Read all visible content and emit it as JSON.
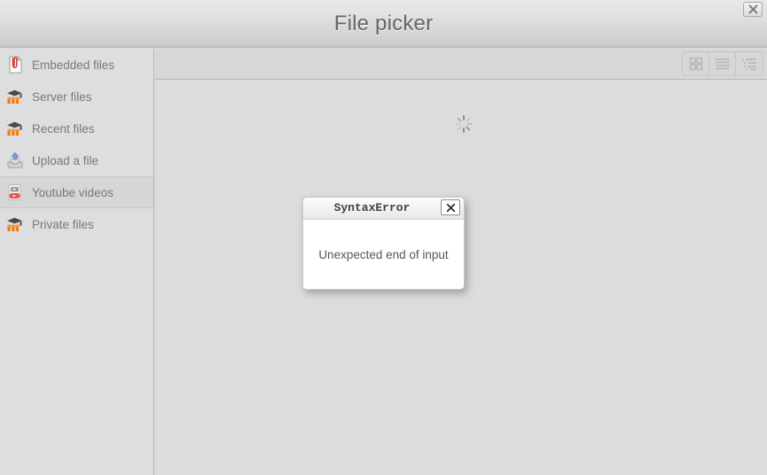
{
  "window": {
    "title": "File picker",
    "close_label": "×",
    "close_icon": "close-icon"
  },
  "sidebar": {
    "items": [
      {
        "label": "Embedded files",
        "icon": "document-paperclip-icon",
        "selected": false
      },
      {
        "label": "Server files",
        "icon": "moodle-logo-icon",
        "selected": false
      },
      {
        "label": "Recent files",
        "icon": "moodle-logo-icon",
        "selected": false
      },
      {
        "label": "Upload a file",
        "icon": "upload-icon",
        "selected": false
      },
      {
        "label": "Youtube videos",
        "icon": "youtube-icon",
        "selected": true
      },
      {
        "label": "Private files",
        "icon": "moodle-logo-icon",
        "selected": false
      }
    ]
  },
  "toolbar": {
    "view_modes": [
      {
        "name": "icon-view",
        "icon": "grid-view-icon",
        "label": "Icon view",
        "active": false
      },
      {
        "name": "list-view",
        "icon": "list-view-icon",
        "label": "List view",
        "active": false
      },
      {
        "name": "tree-view",
        "icon": "tree-view-icon",
        "label": "Tree view",
        "active": false
      }
    ]
  },
  "main": {
    "loading": true,
    "spinner_icon": "loading-spinner-icon"
  },
  "dialog": {
    "title": "SyntaxError",
    "message": "Unexpected end of input",
    "close_label": "✕",
    "close_icon": "close-icon"
  },
  "colors": {
    "header_top": "#e9e9e9",
    "header_bottom": "#c3c3c3",
    "sidebar_bg": "#dedede",
    "sidebar_selected": "#d6d6d6",
    "main_bg": "#dcdcdc",
    "toolbar_bg": "#d7d7d7",
    "title_text": "#63666b",
    "label_text": "#77797d",
    "accent_red": "#d9534f",
    "accent_orange": "#ef7d18"
  }
}
